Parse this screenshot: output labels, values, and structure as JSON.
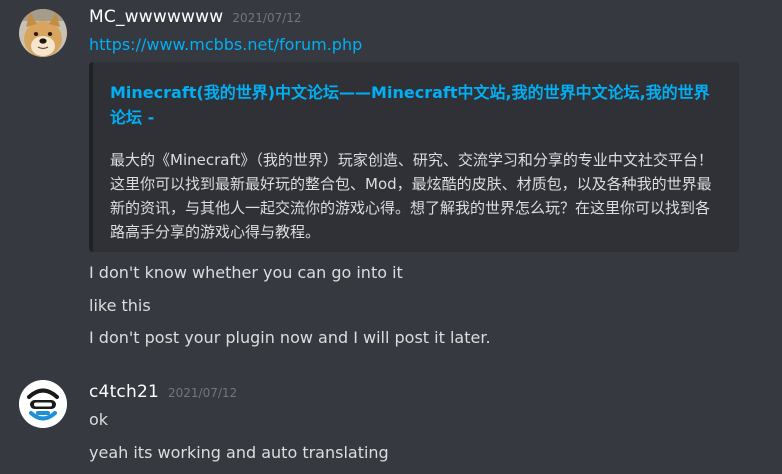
{
  "messages": [
    {
      "username": "MC_wwwwwww",
      "timestamp": "2021/07/12",
      "avatar": "doge-avatar",
      "link": "https://www.mcbbs.net/forum.php",
      "embed": {
        "title": "Minecraft(我的世界)中文论坛——Minecraft中文站,我的世界中文论坛,我的世界论坛 -",
        "description": "最大的《Minecraft》（我的世界）玩家创造、研究、交流学习和分享的专业中文社交平台！这里你可以找到最新最好玩的整合包、Mod，最炫酷的皮肤、材质包，以及各种我的世界最新的资讯，与其他人一起交流你的游戏心得。想了解我的世界怎么玩？在这里你可以找到各路高手分享的游戏心得与教程。"
      },
      "lines": [
        "I don't know whether you can go into it",
        "like this",
        "I don't post your plugin now and I will post it later."
      ]
    },
    {
      "username": "c4tch21",
      "timestamp": "2021/07/12",
      "avatar": "c4-logo-avatar",
      "lines": [
        "ok",
        "yeah its working and auto translating"
      ]
    }
  ],
  "colors": {
    "background": "#36393f",
    "embed_bg": "#2f3136",
    "link": "#00aff4",
    "username": "#ffffff",
    "timestamp": "#72767d",
    "text": "#dcddde"
  }
}
